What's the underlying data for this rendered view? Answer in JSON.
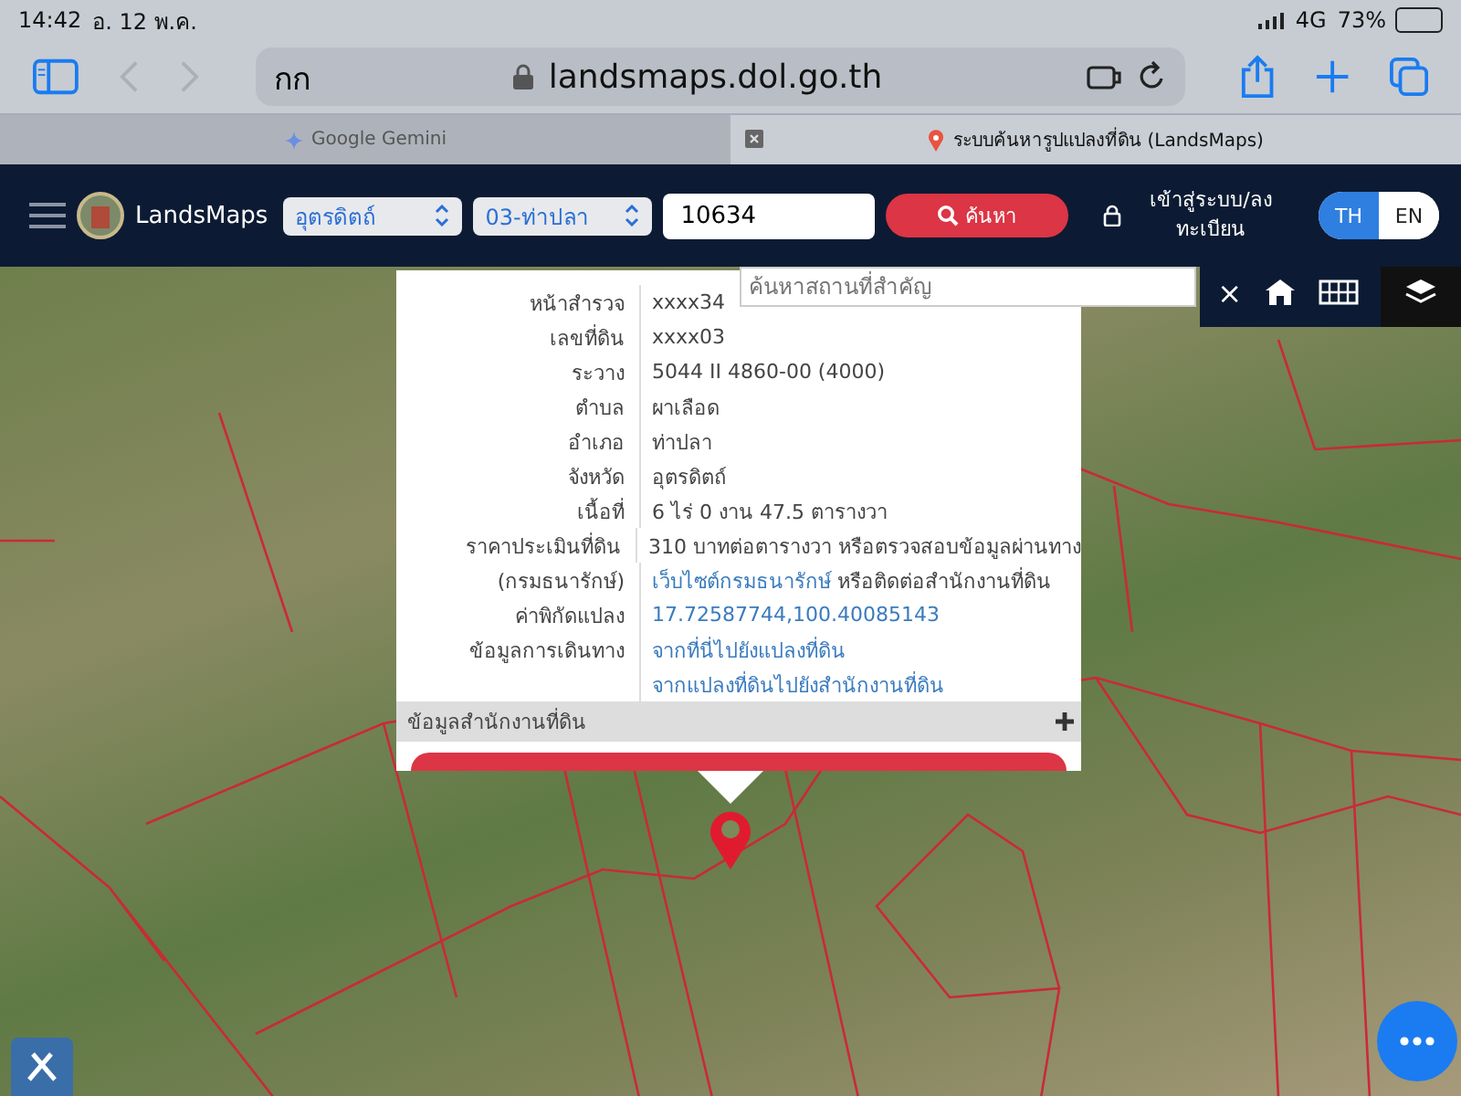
{
  "status_bar": {
    "time": "14:42",
    "date": "อ. 12 พ.ค.",
    "network": "4G",
    "battery": "73%"
  },
  "browser": {
    "reader_label": "กก",
    "url": "landsmaps.dol.go.th",
    "tabs": [
      {
        "title": "Google Gemini",
        "selected": false
      },
      {
        "title": "ระบบค้นหารูปแปลงที่ดิน (LandsMaps)",
        "selected": true
      }
    ]
  },
  "header": {
    "brand": "LandsMaps",
    "province": "อุตรดิตถ์",
    "district": "03-ท่าปลา",
    "parcel_number": "10634",
    "search_button": "ค้นหา",
    "login": "เข้าสู่ระบบ/ลงทะเบียน",
    "languages": [
      {
        "label": "TH",
        "selected": true
      },
      {
        "label": "EN",
        "selected": false
      }
    ]
  },
  "map": {
    "place_search_placeholder": "ค้นหาสถานที่สำคัญ",
    "close": "×"
  },
  "popup": {
    "rows": [
      {
        "label": "หน้าสำรวจ",
        "parts": [
          {
            "text": "xxxx34",
            "link": false
          }
        ]
      },
      {
        "label": "เลขที่ดิน",
        "parts": [
          {
            "text": "xxxx03",
            "link": false
          }
        ]
      },
      {
        "label": "ระวาง",
        "parts": [
          {
            "text": "5044 II 4860-00 (4000)",
            "link": false
          }
        ]
      },
      {
        "label": "ตำบล",
        "parts": [
          {
            "text": "ผาเลือด",
            "link": false
          }
        ]
      },
      {
        "label": "อำเภอ",
        "parts": [
          {
            "text": "ท่าปลา",
            "link": false
          }
        ]
      },
      {
        "label": "จังหวัด",
        "parts": [
          {
            "text": "อุตรดิตถ์",
            "link": false
          }
        ]
      },
      {
        "label": "เนื้อที่",
        "parts": [
          {
            "text": "6 ไร่ 0 งาน 47.5 ตารางวา",
            "link": false
          }
        ]
      },
      {
        "label": "ราคาประเมินที่ดิน",
        "parts": [
          {
            "text": "310 บาทต่อตารางวา หรือตรวจสอบข้อมูลผ่านทาง",
            "link": false
          }
        ]
      },
      {
        "label": "(กรมธนารักษ์)",
        "parts": [
          {
            "text": "เว็บไซต์กรมธนารักษ์",
            "link": true
          },
          {
            "text": " หรือติดต่อสำนักงานที่ดิน",
            "link": false
          }
        ]
      },
      {
        "label": "ค่าพิกัดแปลง",
        "parts": [
          {
            "text": "17.72587744,100.40085143",
            "link": true
          }
        ]
      },
      {
        "label": "ข้อมูลการเดินทาง",
        "parts": [
          {
            "text": "จากที่นี่ไปยังแปลงที่ดิน",
            "link": true
          }
        ]
      },
      {
        "parts": [
          {
            "text": "จากแปลงที่ดินไปยังสำนักงานที่ดิน",
            "link": true
          }
        ]
      }
    ],
    "section": {
      "title": "ข้อมูลสำนักงานที่ดิน",
      "expanded": false
    }
  }
}
